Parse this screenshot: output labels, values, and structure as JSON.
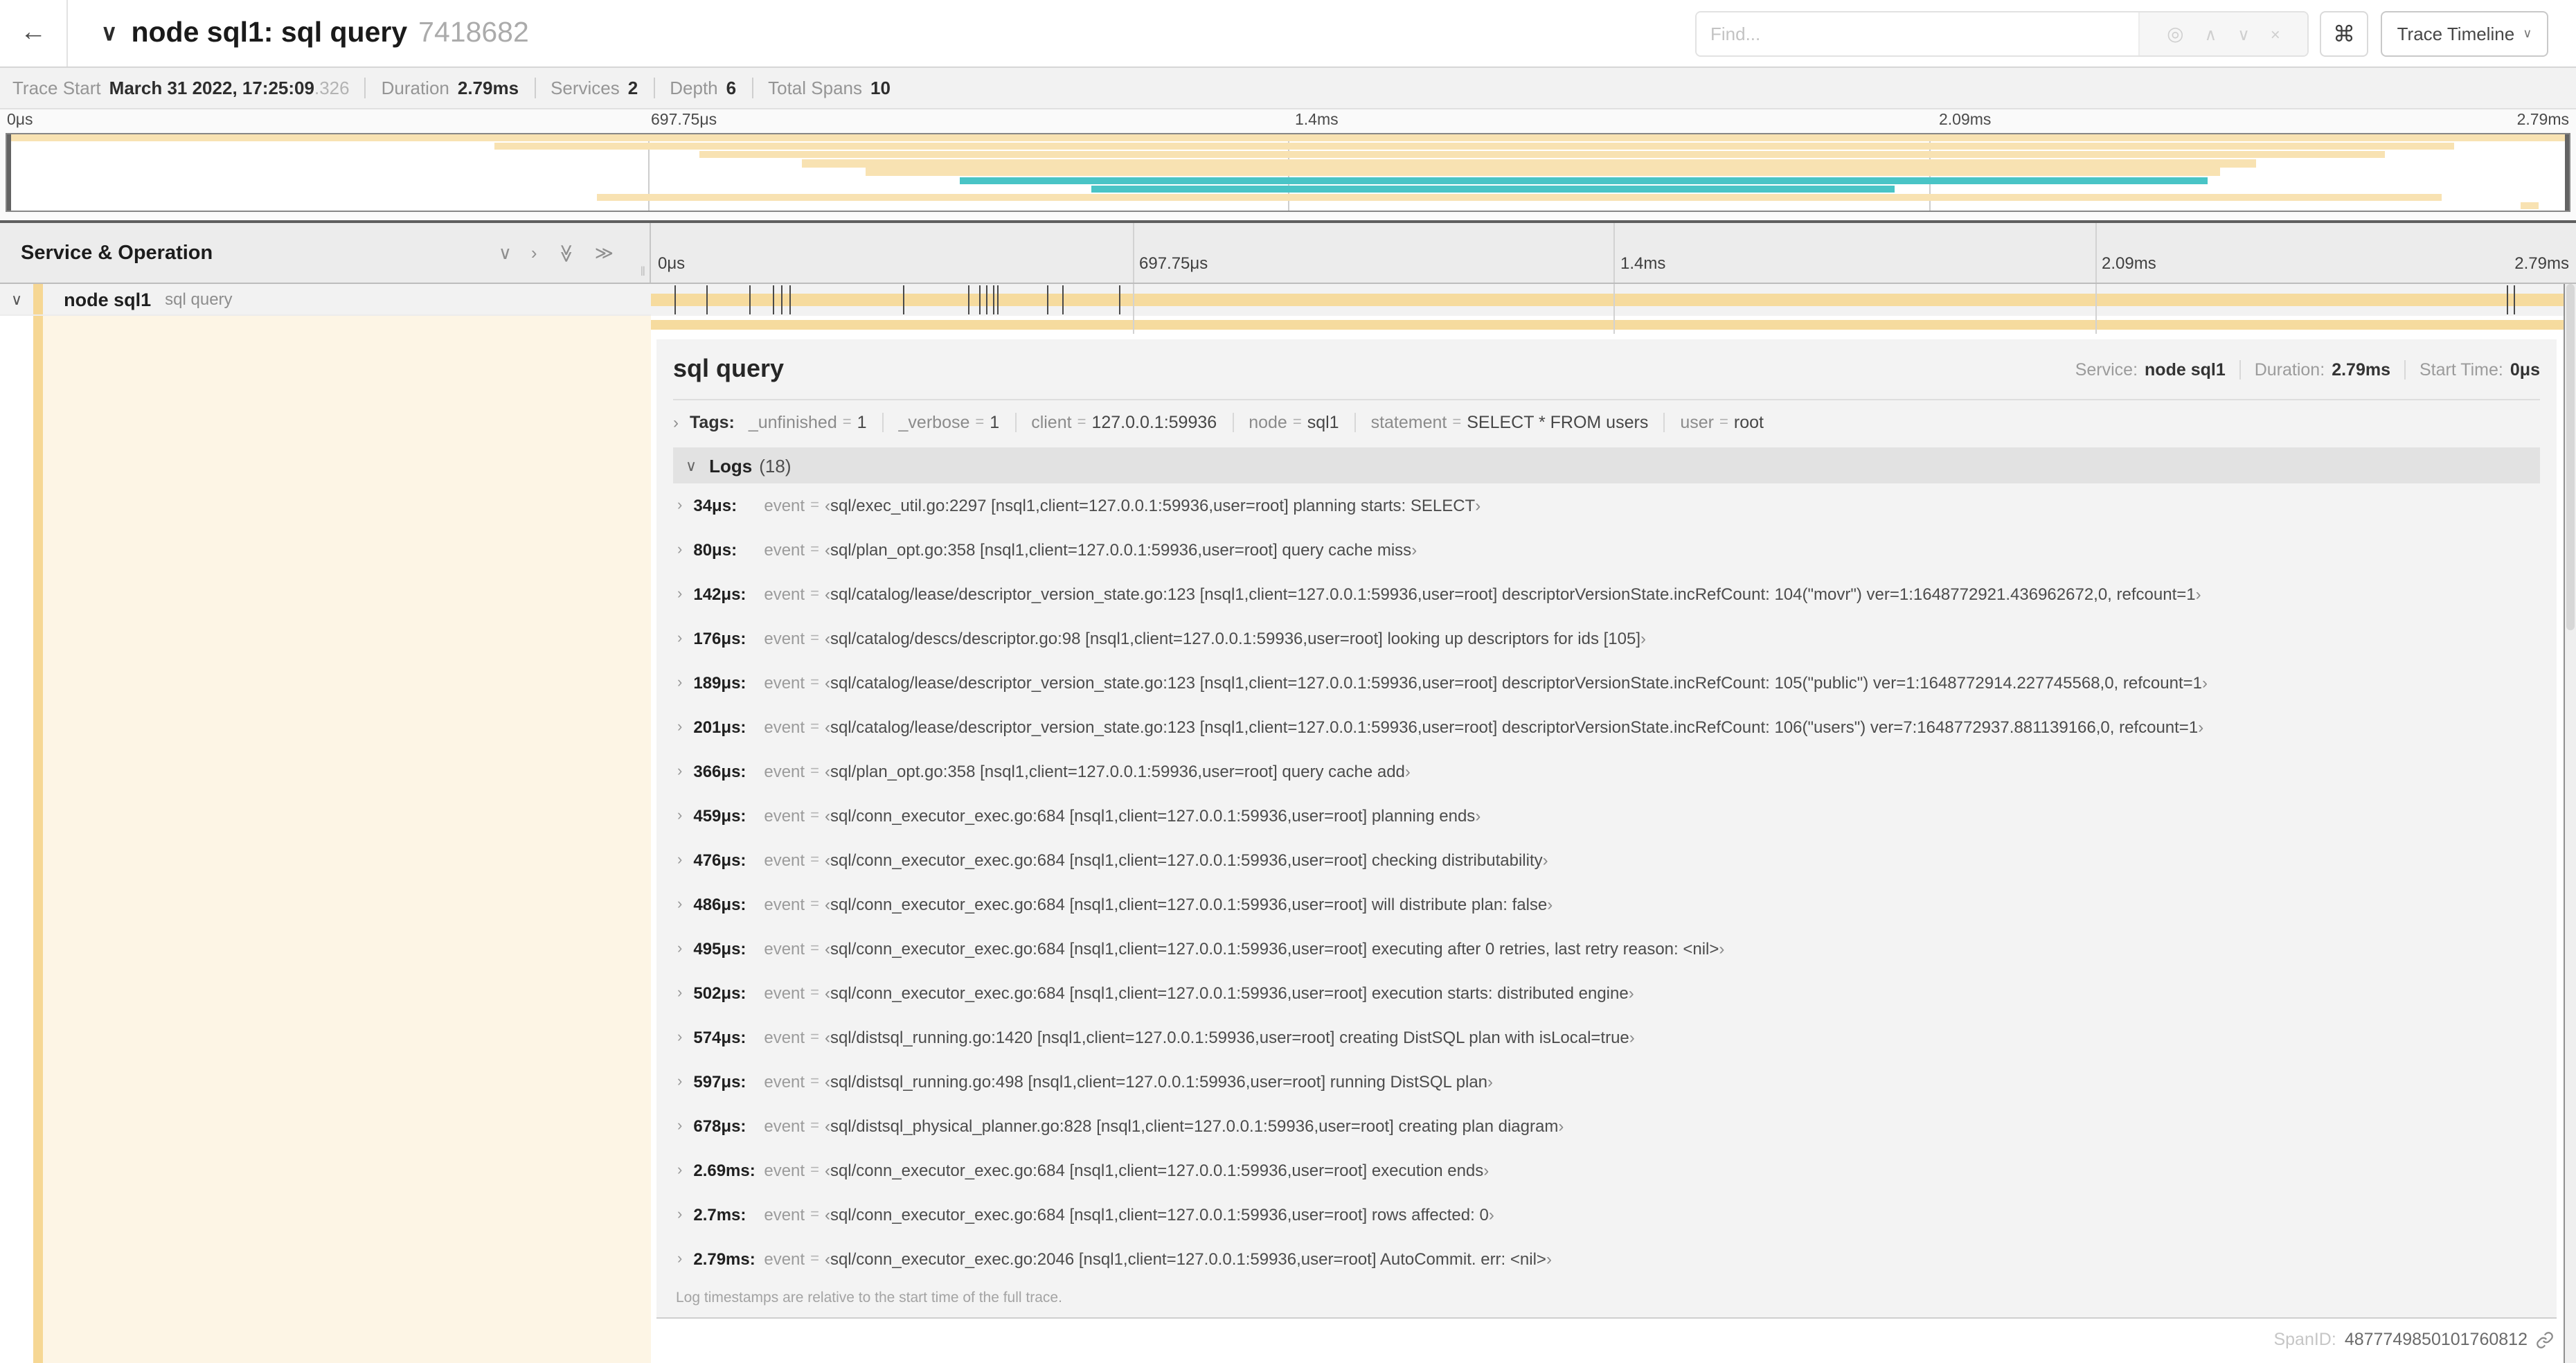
{
  "header": {
    "back_icon": "←",
    "collapse_icon": "∨",
    "title": "node sql1: sql query",
    "trace_id": "7418682",
    "find_placeholder": "Find...",
    "icons": {
      "locate": "◎",
      "prev": "∧",
      "next": "∨",
      "clear": "×"
    },
    "shortcut_icon": "⌘",
    "view_selector": "Trace Timeline",
    "view_caret": "∨"
  },
  "summary": {
    "items": [
      {
        "label": "Trace Start",
        "value": "March 31 2022, 17:25:09",
        "suffix": ".326"
      },
      {
        "label": "Duration",
        "value": "2.79ms"
      },
      {
        "label": "Services",
        "value": "2"
      },
      {
        "label": "Depth",
        "value": "6"
      },
      {
        "label": "Total Spans",
        "value": "10"
      }
    ]
  },
  "minimap": {
    "ticks": [
      "0μs",
      "697.75μs",
      "1.4ms",
      "2.09ms",
      "2.79ms"
    ],
    "gridlines": [
      0.25,
      0.5,
      0.75
    ],
    "row_count": 9,
    "palette": {
      "orange": "#f8e2b2",
      "teal": "#49c4c6"
    },
    "bars": [
      {
        "row": 0,
        "start": 0,
        "end": 1,
        "color": "orange"
      },
      {
        "row": 1,
        "start": 0.19,
        "end": 0.955,
        "color": "orange"
      },
      {
        "row": 2,
        "start": 0.27,
        "end": 0.928,
        "color": "orange"
      },
      {
        "row": 3,
        "start": 0.31,
        "end": 0.878,
        "color": "orange"
      },
      {
        "row": 4,
        "start": 0.335,
        "end": 0.864,
        "color": "orange"
      },
      {
        "row": 5,
        "start": 0.372,
        "end": 0.859,
        "color": "teal"
      },
      {
        "row": 6,
        "start": 0.423,
        "end": 0.737,
        "color": "teal"
      },
      {
        "row": 7,
        "start": 0.23,
        "end": 0.95,
        "color": "orange"
      },
      {
        "row": 8,
        "start": 0.981,
        "end": 0.988,
        "color": "orange"
      }
    ]
  },
  "timeline": {
    "title": "Service & Operation",
    "collapse_icons": [
      "∨",
      "›",
      "≫",
      "≫"
    ],
    "ticks": [
      "0μs",
      "697.75μs",
      "1.4ms",
      "2.09ms",
      "2.79ms"
    ],
    "duration_us": 2790
  },
  "span_row": {
    "chevron": "∨",
    "service": "node sql1",
    "operation": "sql query"
  },
  "detail": {
    "title": "sql query",
    "stats": [
      {
        "label": "Service:",
        "value": "node sql1"
      },
      {
        "label": "Duration:",
        "value": "2.79ms"
      },
      {
        "label": "Start Time:",
        "value": "0μs"
      }
    ],
    "tags": {
      "chevron": "›",
      "label": "Tags:",
      "items": [
        {
          "key": "_unfinished",
          "value": "1"
        },
        {
          "key": "_verbose",
          "value": "1"
        },
        {
          "key": "client",
          "value": "127.0.0.1:59936"
        },
        {
          "key": "node",
          "value": "sql1"
        },
        {
          "key": "statement",
          "value": "SELECT * FROM users"
        },
        {
          "key": "user",
          "value": "root"
        }
      ]
    },
    "logs": {
      "chevron": "∨",
      "label": "Logs",
      "count": "(18)",
      "row_chevron": "›",
      "event_label": "event",
      "eq": "=",
      "open_bracket": "‹",
      "close_bracket": "›",
      "entries": [
        {
          "time": "34μs",
          "us": 34,
          "msg": "sql/exec_util.go:2297 [nsql1,client=127.0.0.1:59936,user=root] planning starts: SELECT"
        },
        {
          "time": "80μs",
          "us": 80,
          "msg": "sql/plan_opt.go:358 [nsql1,client=127.0.0.1:59936,user=root] query cache miss"
        },
        {
          "time": "142μs",
          "us": 142,
          "msg": "sql/catalog/lease/descriptor_version_state.go:123 [nsql1,client=127.0.0.1:59936,user=root] descriptorVersionState.incRefCount: 104(\"movr\") ver=1:1648772921.436962672,0, refcount=1"
        },
        {
          "time": "176μs",
          "us": 176,
          "msg": "sql/catalog/descs/descriptor.go:98 [nsql1,client=127.0.0.1:59936,user=root] looking up descriptors for ids [105]"
        },
        {
          "time": "189μs",
          "us": 189,
          "msg": "sql/catalog/lease/descriptor_version_state.go:123 [nsql1,client=127.0.0.1:59936,user=root] descriptorVersionState.incRefCount: 105(\"public\") ver=1:1648772914.227745568,0, refcount=1"
        },
        {
          "time": "201μs",
          "us": 201,
          "msg": "sql/catalog/lease/descriptor_version_state.go:123 [nsql1,client=127.0.0.1:59936,user=root] descriptorVersionState.incRefCount: 106(\"users\") ver=7:1648772937.881139166,0, refcount=1"
        },
        {
          "time": "366μs",
          "us": 366,
          "msg": "sql/plan_opt.go:358 [nsql1,client=127.0.0.1:59936,user=root] query cache add"
        },
        {
          "time": "459μs",
          "us": 459,
          "msg": "sql/conn_executor_exec.go:684 [nsql1,client=127.0.0.1:59936,user=root] planning ends"
        },
        {
          "time": "476μs",
          "us": 476,
          "msg": "sql/conn_executor_exec.go:684 [nsql1,client=127.0.0.1:59936,user=root] checking distributability"
        },
        {
          "time": "486μs",
          "us": 486,
          "msg": "sql/conn_executor_exec.go:684 [nsql1,client=127.0.0.1:59936,user=root] will distribute plan: false"
        },
        {
          "time": "495μs",
          "us": 495,
          "msg": "sql/conn_executor_exec.go:684 [nsql1,client=127.0.0.1:59936,user=root] executing after 0 retries, last retry reason: <nil>"
        },
        {
          "time": "502μs",
          "us": 502,
          "msg": "sql/conn_executor_exec.go:684 [nsql1,client=127.0.0.1:59936,user=root] execution starts: distributed engine"
        },
        {
          "time": "574μs",
          "us": 574,
          "msg": "sql/distsql_running.go:1420 [nsql1,client=127.0.0.1:59936,user=root] creating DistSQL plan with isLocal=true"
        },
        {
          "time": "597μs",
          "us": 597,
          "msg": "sql/distsql_running.go:498 [nsql1,client=127.0.0.1:59936,user=root] running DistSQL plan"
        },
        {
          "time": "678μs",
          "us": 678,
          "msg": "sql/distsql_physical_planner.go:828 [nsql1,client=127.0.0.1:59936,user=root] creating plan diagram"
        },
        {
          "time": "2.69ms",
          "us": 2690,
          "msg": "sql/conn_executor_exec.go:684 [nsql1,client=127.0.0.1:59936,user=root] execution ends"
        },
        {
          "time": "2.7ms",
          "us": 2700,
          "msg": "sql/conn_executor_exec.go:684 [nsql1,client=127.0.0.1:59936,user=root] rows affected: 0"
        },
        {
          "time": "2.79ms",
          "us": 2790,
          "msg": "sql/conn_executor_exec.go:2046 [nsql1,client=127.0.0.1:59936,user=root] AutoCommit. err: <nil>"
        }
      ]
    },
    "footer_note": "Log timestamps are relative to the start time of the full trace.",
    "spanid_label": "SpanID:",
    "spanid": "4877749850101760812"
  }
}
